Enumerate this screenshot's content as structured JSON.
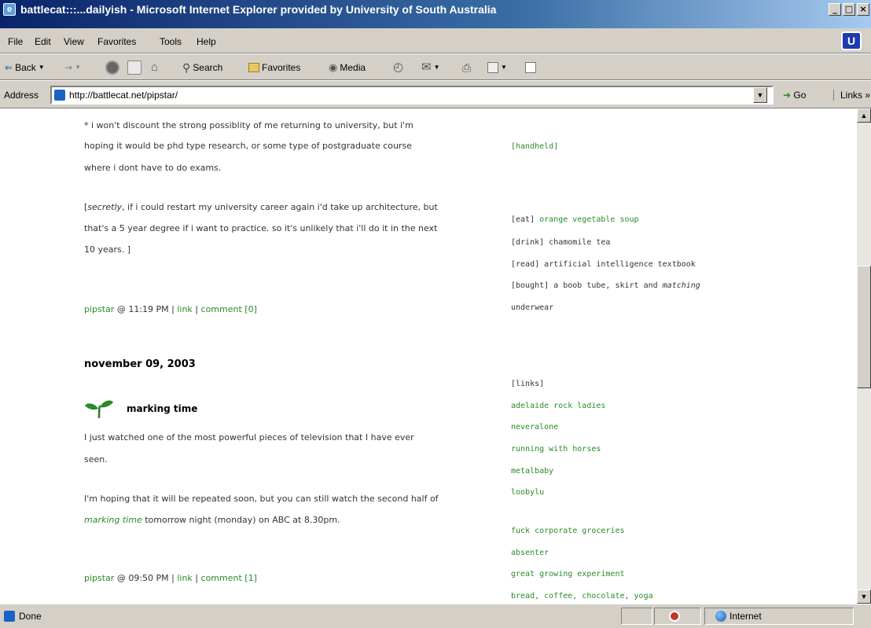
{
  "window": {
    "title": "battlecat:::...dailyish - Microsoft Internet Explorer provided by University of South Australia",
    "min": "_",
    "max": "□",
    "close": "×",
    "brand_icon": "unisa-shield-icon",
    "brand_letter": "U"
  },
  "menu": {
    "file": "File",
    "edit": "Edit",
    "view": "View",
    "favorites": "Favorites",
    "tools": "Tools",
    "help": "Help"
  },
  "toolbar": {
    "back": "Back",
    "forward_arrow": "→",
    "back_arrow": "⇐",
    "search": "Search",
    "favorites": "Favorites",
    "media": "Media"
  },
  "address": {
    "label": "Address",
    "url": "http://battlecat.net/pipstar/",
    "go": "Go",
    "links": "Links »"
  },
  "blog": {
    "p1_l1": "* i won't discount the strong possiblity of me returning to university, but i'm",
    "p1_l2": "hoping it would be phd type research, or some type of postgraduate course",
    "p1_l3": "where i dont have to do exams.",
    "p2_l1_open": "[",
    "p2_l1_em": "secretly",
    "p2_l1_rest": ", if i could restart my university career again i'd take up architecture, but",
    "p2_l2": "that's a 5 year degree if i want to practice. so it's unlikely that i'll do it in the next",
    "p2_l3": "10 years. ]",
    "footer1_author": "pipstar",
    "footer1_time": " @ 11:19 PM | ",
    "footer1_link": "link",
    "footer1_sep": " | ",
    "footer1_comment": "comment [0]",
    "date_header": "november 09, 2003",
    "post_icon": "sprout-icon",
    "post_title": "marking time",
    "p3_l1": "I just watched one of the most powerful pieces of television that I have ever",
    "p3_l2": "seen.",
    "p4_l1": "I'm hoping that it will be repeated soon, but you can still watch the second half of",
    "p4_l2_em": "marking time",
    "p4_l2_rest": " tomorrow night (monday) on ABC at 8.30pm.",
    "footer2_author": "pipstar",
    "footer2_time": " @ 09:50 PM | ",
    "footer2_link": "link",
    "footer2_sep": " | ",
    "footer2_comment": "comment [1]"
  },
  "sidebar": {
    "handheld": "[handheld]",
    "eat_tag": "[eat] ",
    "eat_val": "orange vegetable soup",
    "drink": "[drink] chamomile tea",
    "read": "[read] artificial intelligence textbook",
    "bought_a": "[bought] a boob tube, skirt and ",
    "bought_em": "matching",
    "bought_b": "underwear",
    "links_header": "[links]",
    "links": [
      "adelaide rock ladies",
      "neveralone",
      "running with horses",
      "metalbaby",
      "loobylu",
      "fuck corporate groceries",
      "absenter",
      "great growing experiment",
      "bread, coffee, chocolate, yoga"
    ]
  },
  "status": {
    "text": "Done",
    "zone": "Internet"
  },
  "colors": {
    "link_green": "#2a8a2a",
    "chrome": "#d4d0c8",
    "titlebar": "#0a246a"
  }
}
